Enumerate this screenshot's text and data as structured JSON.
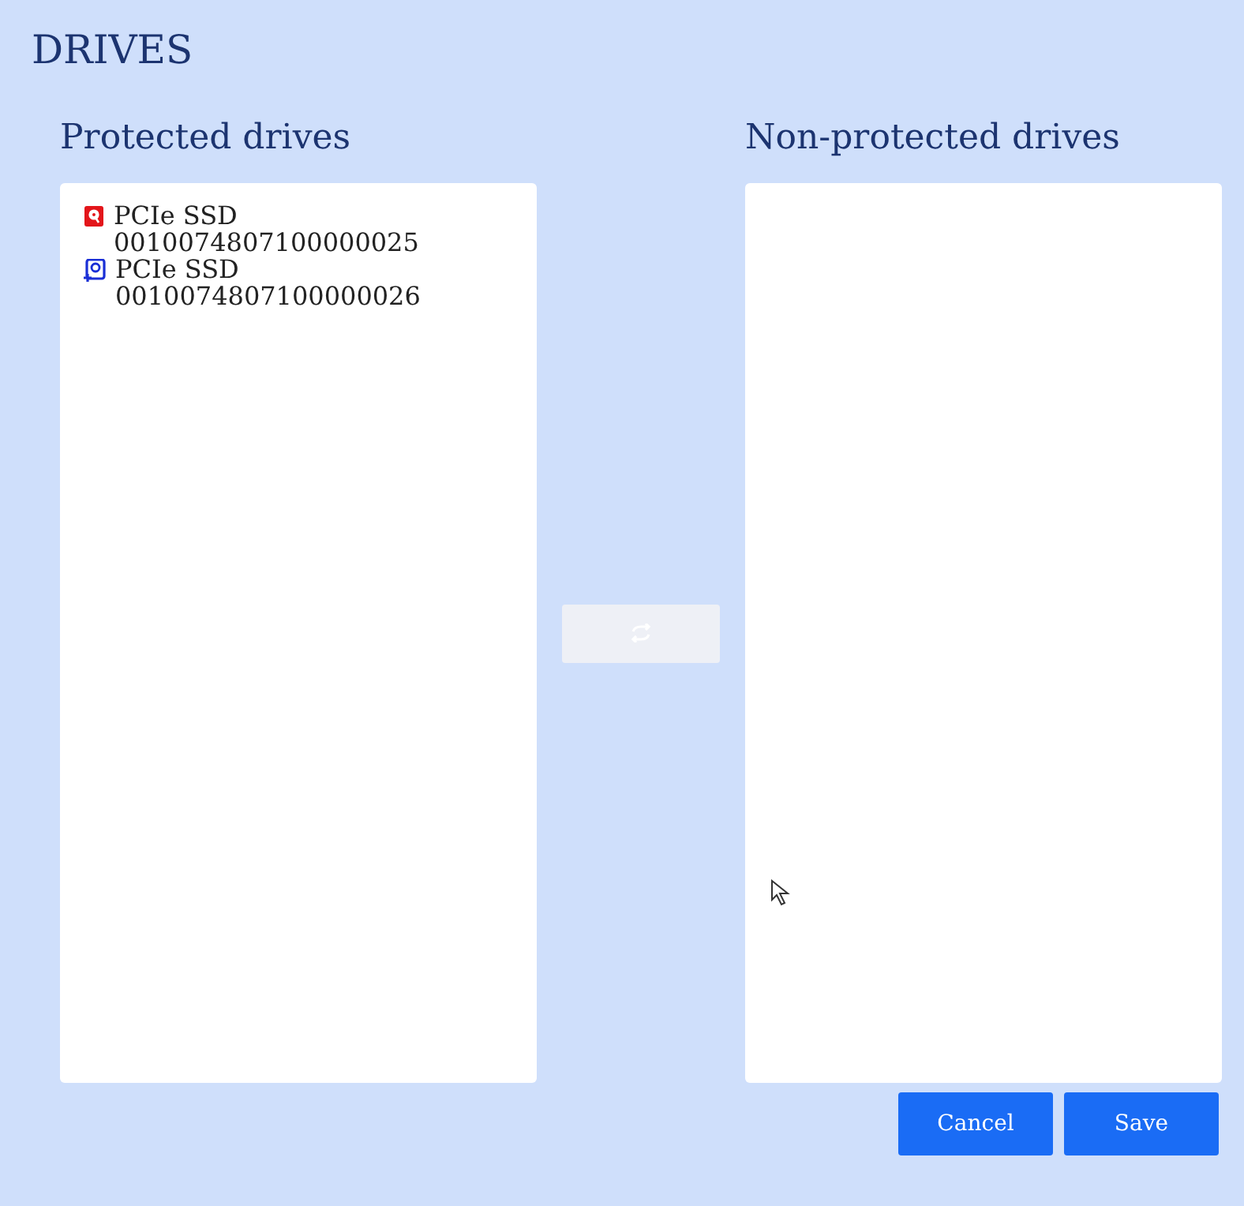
{
  "title": "DRIVES",
  "protected": {
    "heading": "Protected drives",
    "drives": [
      {
        "kind": "protected",
        "name": "PCIe SSD",
        "serial": "0010074807100000025"
      },
      {
        "kind": "syncing",
        "name": "PCIe SSD",
        "serial": "0010074807100000026"
      }
    ]
  },
  "transfer_button": {
    "disabled": true
  },
  "unprotected": {
    "heading": "Non-protected drives"
  },
  "buttons": [
    "Cancel",
    "Save"
  ]
}
